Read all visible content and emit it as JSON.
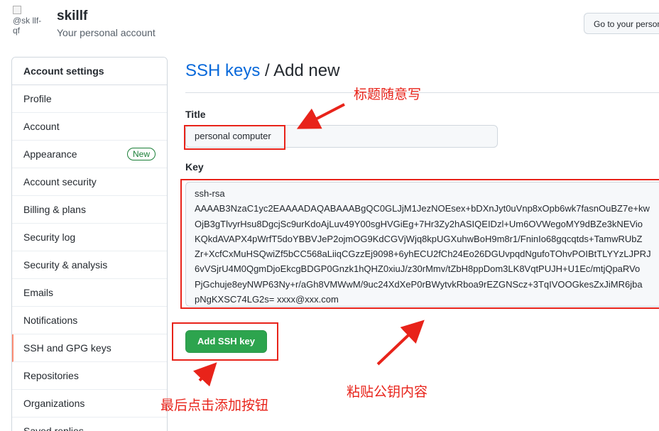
{
  "header": {
    "avatar_alt": "@sk llf-qf",
    "username": "skillf",
    "subtitle": "Your personal account",
    "goto_button": "Go to your personal profile"
  },
  "sidebar": {
    "heading": "Account settings",
    "items": [
      {
        "label": "Profile"
      },
      {
        "label": "Account"
      },
      {
        "label": "Appearance",
        "badge": "New"
      },
      {
        "label": "Account security"
      },
      {
        "label": "Billing & plans"
      },
      {
        "label": "Security log"
      },
      {
        "label": "Security & analysis"
      },
      {
        "label": "Emails"
      },
      {
        "label": "Notifications"
      },
      {
        "label": "SSH and GPG keys",
        "active": true
      },
      {
        "label": "Repositories"
      },
      {
        "label": "Organizations"
      },
      {
        "label": "Saved replies"
      }
    ]
  },
  "main": {
    "breadcrumb_link": "SSH keys",
    "breadcrumb_sep": "/",
    "breadcrumb_current": "Add new",
    "title_label": "Title",
    "title_value": "personal computer",
    "key_label": "Key",
    "key_lines": [
      "ssh-rsa",
      "AAAAB3NzaC1yc2EAAAADAQABAAABgQC0GLJjM1JezNOEsex+bDXnJyt0uVnp8xOpb6wk7fasnOuBZ7e+kw",
      "OjB3gTlvyrHsu8DgcjSc9urKdoAjLuv49Y00sgHVGiEg+7Hr3Zy2hASIQEIDzl+Um6OVWegoMY9dBZe3kNEVio",
      "KQkdAVAPX4pWrfT5doYBBVJeP2ojmOG9KdCGVjWjq8kpUGXuhwBoH9m8r1/FninIo68gqcqtds+TamwRUbZ",
      "Zr+XcfCxMuHSQwiZf5bCC568aLiiqCGzzEj9098+6yhECU2fCh24Eo26DGUvpqdNgufoTOhvPOIBtTLYYzLJPRJ",
      "6vVSjrU4M0QgmDjoEkcgBDGP0Gnzk1hQHZ0xiuJ/z30rMmv/tZbH8ppDom3LK8VqtPUJH+U1Ec/mtjQpaRVo",
      "PjGchuje8eyNWP63Ny+r/aGh8VMWwM/9uc24XdXeP0rBWytvkRboa9rEZGNScz+3TqIVOOGkesZxJiMR6jba",
      "pNgKXSC74LG2s= xxxx@xxx.com"
    ],
    "submit_button": "Add SSH key"
  },
  "annotations": {
    "title_note": "标题随意写",
    "key_note": "粘贴公钥内容",
    "button_note": "最后点击添加按钮",
    "color": "#e8231a"
  }
}
